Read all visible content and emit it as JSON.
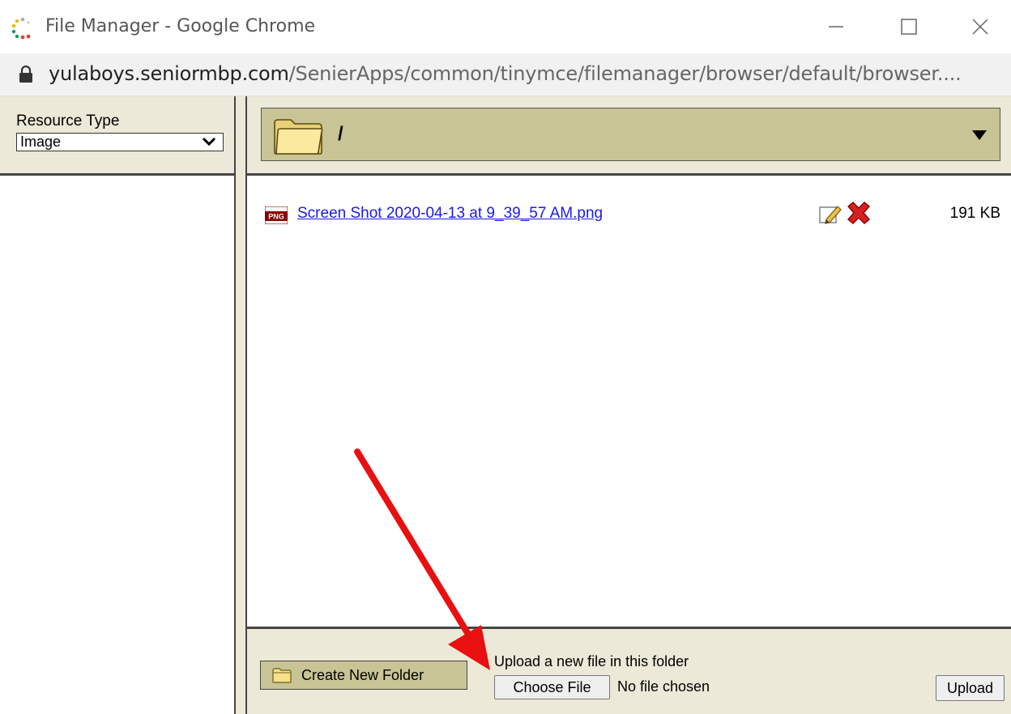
{
  "window": {
    "title": "File Manager - Google Chrome"
  },
  "address_bar": {
    "host": "yulaboys.seniormbp.com",
    "path": "/SenierApps/common/tinymce/filemanager/browser/default/browser...."
  },
  "left_panel": {
    "resource_type_label": "Resource Type",
    "resource_type_value": "Image"
  },
  "folder": {
    "current_path": "/"
  },
  "files": [
    {
      "name": "Screen Shot 2020-04-13 at 9_39_57 AM.png",
      "size": "191 KB",
      "type_badge": "PNG"
    }
  ],
  "bottom": {
    "create_folder_label": "Create New Folder",
    "upload_label": "Upload a new file in this folder",
    "choose_file_label": "Choose File",
    "no_file_text": "No file chosen",
    "upload_button_label": "Upload"
  },
  "colors": {
    "panel_bg": "#ece9d8",
    "folder_bar_bg": "#c8c495",
    "link": "#1a1ae6",
    "annotation_arrow": "#e81010"
  }
}
